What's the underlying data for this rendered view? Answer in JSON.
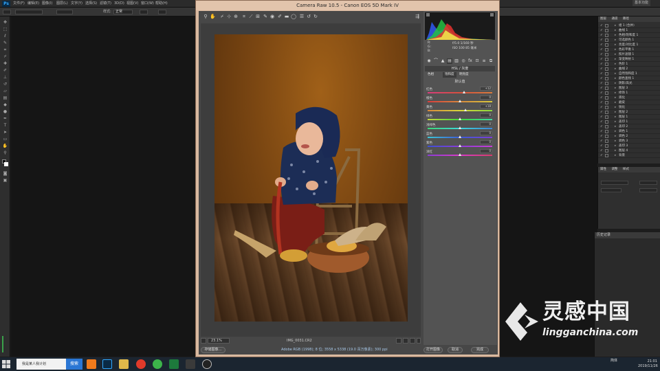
{
  "app": {
    "logo": "Ps",
    "menus": [
      "文件(F)",
      "编辑(E)",
      "图像(I)",
      "图层(L)",
      "文字(Y)",
      "选择(S)",
      "滤镜(T)",
      "3D(D)",
      "视图(V)",
      "窗口(W)",
      "帮助(H)"
    ],
    "workspace": "基本功能"
  },
  "options_bar": {
    "style_label": "样式:",
    "style_value": "正常"
  },
  "dialog": {
    "title": "Camera Raw 10.5  -  Canon EOS 5D Mark IV",
    "zoom": "23.1%",
    "filename": "IMG_0031.CR2",
    "save_button": "存储图像...",
    "info_text": "Adobe RGB (1998); 8 位; 3558 x 5338 (19.0 百万像素); 300 ppi",
    "open_button": "打开图像",
    "cancel_button": "取消",
    "done_button": "完成",
    "histogram_readout": [
      "f/5.0   1/160 秒",
      "ISO 100   85 毫米"
    ],
    "rgb_labels": [
      "R:",
      "G:",
      "B:"
    ],
    "panel_title": "HSL / 灰度",
    "subtabs": [
      "色相",
      "饱和度",
      "明亮度"
    ],
    "default_label": "默认值",
    "sliders": [
      {
        "label": "红色",
        "value": "+12",
        "pos": 0.56,
        "track": "linear-gradient(90deg,#d83c7c,#d8503c,#d87a3c)"
      },
      {
        "label": "橙色",
        "value": "0",
        "pos": 0.5,
        "track": "linear-gradient(90deg,#d83c3c,#d8883c,#d8c83c)"
      },
      {
        "label": "黄色",
        "value": "+18",
        "pos": 0.59,
        "track": "linear-gradient(90deg,#d8883c,#d8d83c,#8cd83c)"
      },
      {
        "label": "绿色",
        "value": "0",
        "pos": 0.5,
        "track": "linear-gradient(90deg,#c8d83c,#3cd83c,#3cd8a0)"
      },
      {
        "label": "浅绿色",
        "value": "0",
        "pos": 0.5,
        "track": "linear-gradient(90deg,#3cd878,#3cd8d8,#3c88d8)"
      },
      {
        "label": "蓝色",
        "value": "0",
        "pos": 0.5,
        "track": "linear-gradient(90deg,#3cc8d8,#3c5cd8,#7c3cd8)"
      },
      {
        "label": "紫色",
        "value": "0",
        "pos": 0.5,
        "track": "linear-gradient(90deg,#3c50d8,#8c3cd8,#c83cd8)"
      },
      {
        "label": "洋红",
        "value": "0",
        "pos": 0.5,
        "track": "linear-gradient(90deg,#8c3cd8,#d83cc8,#d83c6c)"
      }
    ]
  },
  "layers_panel": {
    "tabs": [
      "图层",
      "通道",
      "路径"
    ],
    "items": [
      {
        "name": "组 1 (合并)",
        "checked": true
      },
      {
        "name": "曲线 1",
        "checked": true
      },
      {
        "name": "色相/饱和度 1",
        "checked": true
      },
      {
        "name": "可选颜色 1",
        "checked": true
      },
      {
        "name": "亮度/对比度 1",
        "checked": true
      },
      {
        "name": "色彩平衡 1",
        "checked": true
      },
      {
        "name": "照片滤镜 1",
        "checked": true
      },
      {
        "name": "渐变映射 1",
        "checked": true
      },
      {
        "name": "色阶 1",
        "checked": true
      },
      {
        "name": "曲线 2",
        "checked": true
      },
      {
        "name": "自然饱和度 1",
        "checked": true
      },
      {
        "name": "颜色查找 1",
        "checked": true
      },
      {
        "name": "阴影/高光",
        "checked": true
      },
      {
        "name": "图层 3",
        "checked": true
      },
      {
        "name": "修饰 1",
        "checked": true
      },
      {
        "name": "液化",
        "checked": true
      },
      {
        "name": "磨皮",
        "checked": true
      },
      {
        "name": "锐化",
        "checked": true
      },
      {
        "name": "图层 2",
        "checked": true
      },
      {
        "name": "图层 1",
        "checked": true
      },
      {
        "name": "盖印 1",
        "checked": true
      },
      {
        "name": "盖印 2",
        "checked": true
      },
      {
        "name": "调色 1",
        "checked": true
      },
      {
        "name": "调色 2",
        "checked": true
      },
      {
        "name": "调色 3",
        "checked": true
      },
      {
        "name": "盖印 3",
        "checked": true
      },
      {
        "name": "图层 4",
        "checked": true
      },
      {
        "name": "背景",
        "checked": true
      }
    ]
  },
  "properties_panel": {
    "tabs": [
      "属性",
      "调整",
      "样式"
    ]
  },
  "history_panel": {
    "title": "历史记录"
  },
  "watermark": {
    "brand": "灵感中国",
    "url": "lingganchina.com"
  },
  "taskbar": {
    "search_placeholder": "我是某人我计划",
    "search_button": "搜索",
    "tray_text": "简体",
    "time": "21:01",
    "date": "2019/11/26"
  }
}
